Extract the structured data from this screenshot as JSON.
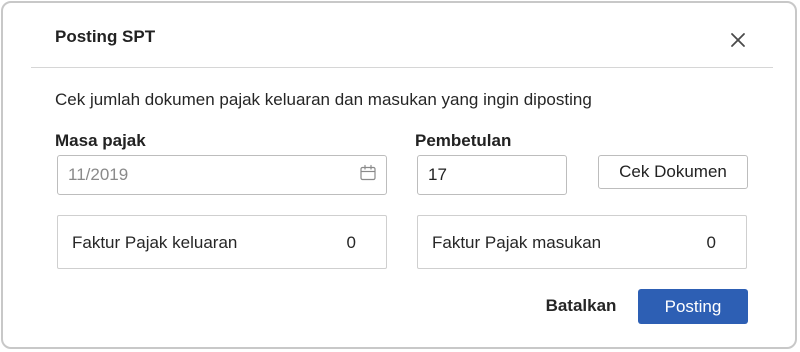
{
  "dialog": {
    "title": "Posting SPT",
    "instruction": "Cek jumlah dokumen pajak keluaran dan masukan yang ingin diposting"
  },
  "form": {
    "masa_pajak_label": "Masa pajak",
    "masa_pajak_value": "11/2019",
    "pembetulan_label": "Pembetulan",
    "pembetulan_value": "17",
    "cek_dokumen_label": "Cek Dokumen"
  },
  "summary": {
    "keluaran_label": "Faktur Pajak keluaran",
    "keluaran_count": "0",
    "masukan_label": "Faktur Pajak masukan",
    "masukan_count": "0"
  },
  "footer": {
    "cancel_label": "Batalkan",
    "posting_label": "Posting"
  },
  "icons": {
    "close": "close-icon",
    "calendar": "calendar-icon"
  },
  "colors": {
    "primary": "#2d5fb4",
    "border": "#bdbdbd",
    "text": "#222222"
  }
}
